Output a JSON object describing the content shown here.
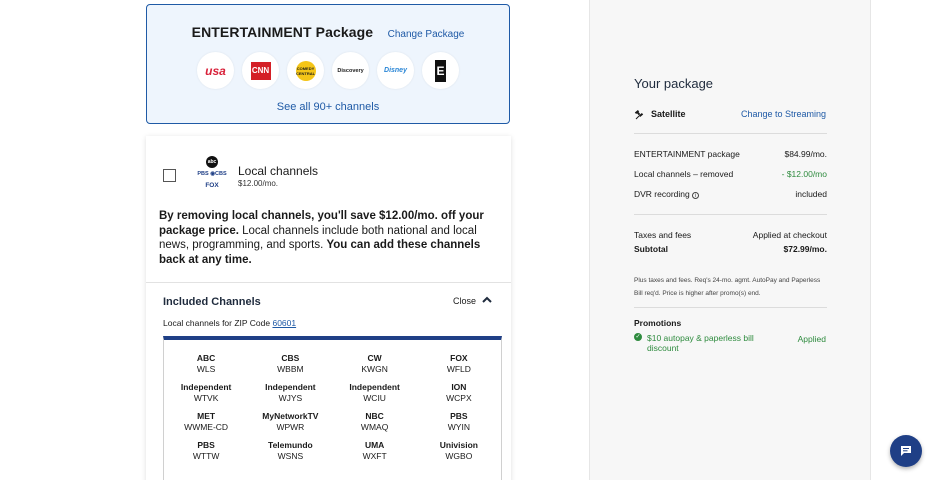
{
  "package_card": {
    "title": "ENTERTAINMENT Package",
    "change_label": "Change Package",
    "logos": [
      {
        "name": "usa-logo",
        "text": "usa"
      },
      {
        "name": "cnn-logo",
        "text": "CNN"
      },
      {
        "name": "comedy-central-logo",
        "text": "COMEDY CENTRAL"
      },
      {
        "name": "discovery-logo",
        "text": "Discovery"
      },
      {
        "name": "disney-junior-logo",
        "text": "Disney"
      },
      {
        "name": "e-logo",
        "text": "E"
      }
    ],
    "see_all": "See all 90+ channels"
  },
  "local_card": {
    "logos": {
      "abc": "abc",
      "pbs_cbs": "PBS ◉CBS",
      "fox": "FOX"
    },
    "title": "Local channels",
    "price": "$12.00/mo.",
    "msg_bold1": "By removing local channels, you'll save $12.00/mo. off your package price.",
    "msg_normal": " Local channels include both national and local news, programming, and sports. ",
    "msg_bold2": "You can add these channels back at any time.",
    "included_title": "Included Channels",
    "close_label": "Close",
    "zip_prefix": "Local channels for ZIP Code ",
    "zip_code": "60601",
    "channels": [
      {
        "network": "ABC",
        "call": "WLS"
      },
      {
        "network": "CBS",
        "call": "WBBM"
      },
      {
        "network": "CW",
        "call": "KWGN"
      },
      {
        "network": "FOX",
        "call": "WFLD"
      },
      {
        "network": "Independent",
        "call": "WTVK"
      },
      {
        "network": "Independent",
        "call": "WJYS"
      },
      {
        "network": "Independent",
        "call": "WCIU"
      },
      {
        "network": "ION",
        "call": "WCPX"
      },
      {
        "network": "MET",
        "call": "WWME-CD"
      },
      {
        "network": "MyNetworkTV",
        "call": "WPWR"
      },
      {
        "network": "NBC",
        "call": "WMAQ"
      },
      {
        "network": "PBS",
        "call": "WYIN"
      },
      {
        "network": "PBS",
        "call": "WTTW"
      },
      {
        "network": "Telemundo",
        "call": "WSNS"
      },
      {
        "network": "UMA",
        "call": "WXFT"
      },
      {
        "network": "Univision",
        "call": "WGBO"
      }
    ]
  },
  "sidebar": {
    "title": "Your package",
    "service": "Satellite",
    "change_streaming": "Change to Streaming",
    "lines": {
      "pkg_label": "ENTERTAINMENT package",
      "pkg_value": "$84.99/mo.",
      "local_label": "Local channels – removed",
      "local_value": "- $12.00/mo",
      "dvr_label": "DVR recording",
      "dvr_value": "included",
      "taxes_label": "Taxes and fees",
      "taxes_value": "Applied at checkout",
      "subtotal_label": "Subtotal",
      "subtotal_value": "$72.99/mo."
    },
    "fine_print": "Plus taxes and fees. Req's 24-mo. agmt. AutoPay and Paperless Bill req'd. Price is higher after promo(s) end.",
    "promotions_title": "Promotions",
    "promo_text": "$10 autopay & paperless bill discount",
    "promo_status": "Applied"
  },
  "colors": {
    "accent": "#1f5aa6",
    "navy": "#1f3f86",
    "green": "#2e8b3e"
  }
}
